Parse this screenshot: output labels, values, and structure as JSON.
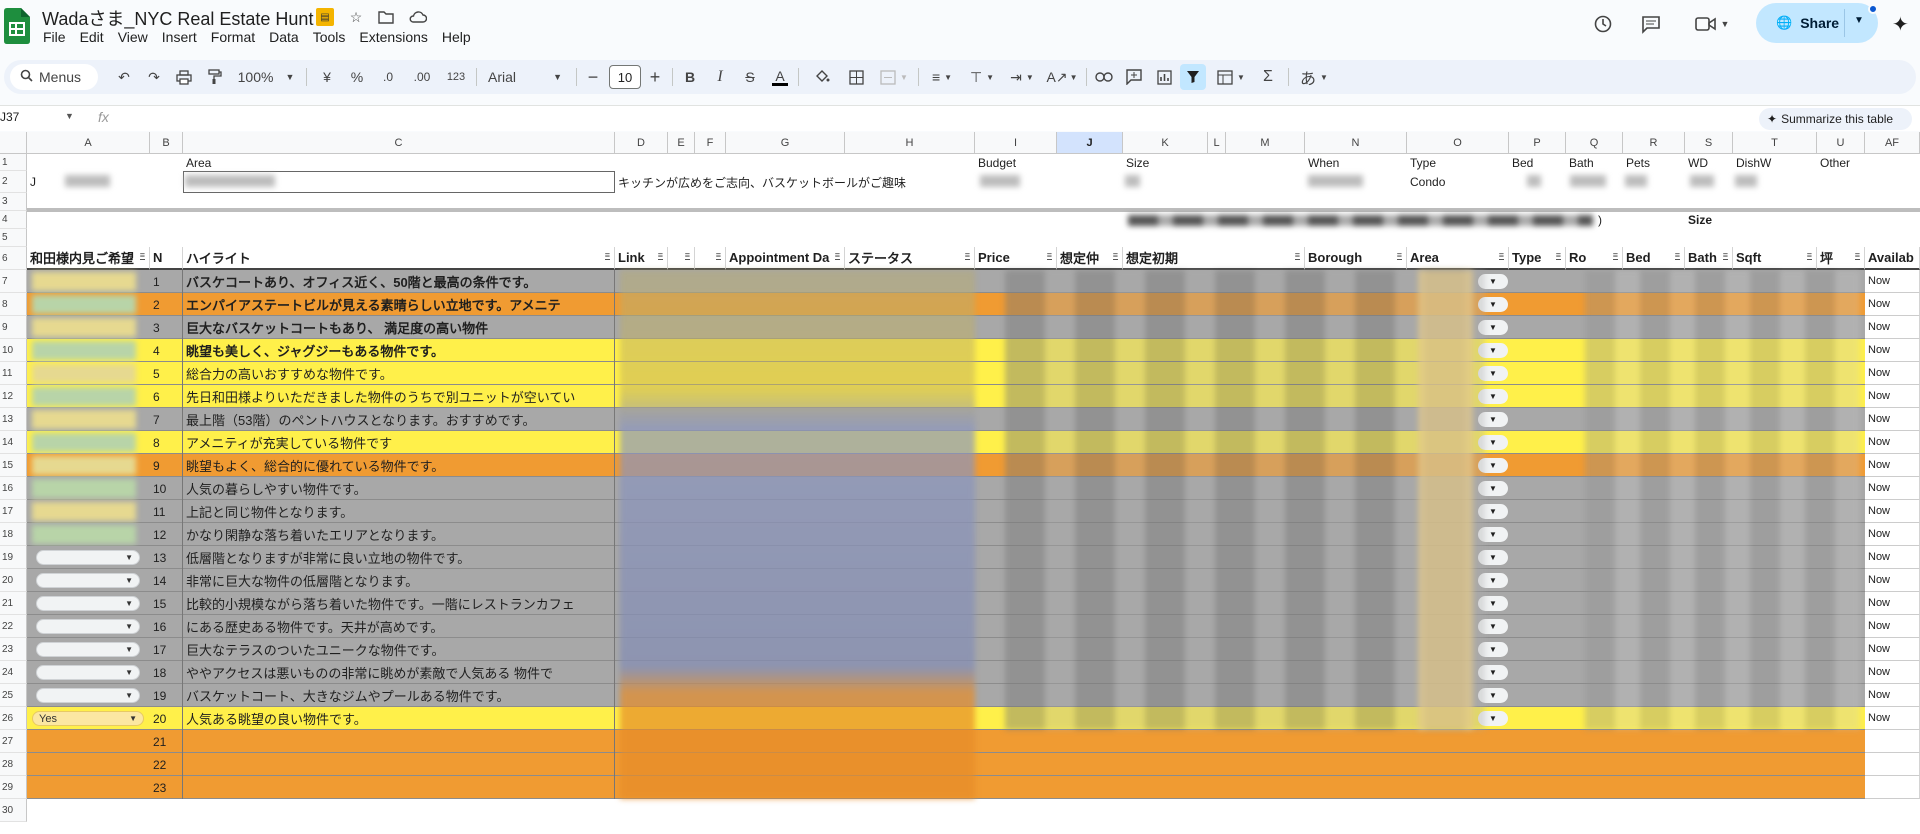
{
  "app": {
    "title": "Wadaさま_NYC Real Estate Hunt",
    "menu": [
      "File",
      "Edit",
      "View",
      "Insert",
      "Format",
      "Data",
      "Tools",
      "Extensions",
      "Help"
    ],
    "share_label": "Share",
    "colors": {
      "accent": "#0b57d0",
      "share_bg": "#c2e7ff",
      "toolbar_bg": "#edf2fa",
      "orange": "#f09b32",
      "yellow": "#fff04a",
      "gray": "#a8a8a8"
    }
  },
  "toolbar": {
    "search_label": "Menus",
    "zoom": "100%",
    "currency": "¥",
    "percent": "%",
    "dec_decrease": ".0",
    "dec_increase": ".00",
    "format_123": "123",
    "font": "Arial",
    "font_size": "10",
    "bold": "B",
    "italic": "I",
    "strike": "S",
    "text_color": "A",
    "sum": "Σ",
    "ime": "あ"
  },
  "formula_bar": {
    "name_box": "J37",
    "fx": "fx",
    "summarize_label": "Summarize this table"
  },
  "grid": {
    "columns": [
      "A",
      "B",
      "C",
      "D",
      "E",
      "F",
      "G",
      "H",
      "I",
      "J",
      "K",
      "L",
      "M",
      "N",
      "O",
      "P",
      "Q",
      "R",
      "S",
      "T",
      "U",
      "AF"
    ],
    "row_numbers": [
      "1",
      "2",
      "3",
      "4",
      "5",
      "6",
      "7",
      "8",
      "9",
      "10",
      "11",
      "12",
      "13",
      "14",
      "15",
      "16",
      "17",
      "18",
      "19",
      "20",
      "21",
      "22",
      "23",
      "24",
      "25",
      "26",
      "27",
      "28",
      "29",
      "30"
    ],
    "row1": {
      "area": "Area",
      "budget": "Budget",
      "size": "Size",
      "when": "When",
      "type": "Type",
      "bed": "Bed",
      "bath": "Bath",
      "pets": "Pets",
      "wd": "WD",
      "dishw": "DishW",
      "other": "Other"
    },
    "row2": {
      "name": "J",
      "note": "キッチンが広めをご志向、バスケットボールがご趣味",
      "type": "Condo"
    },
    "row4": {
      "size": "Size",
      "tail": ")"
    },
    "headers": {
      "a": "和田様内見ご希望",
      "b": "N",
      "c": "ハイライト",
      "d": "Link",
      "g": "Appointment Da",
      "h": "ステータス",
      "i": "Price",
      "j": "想定仲",
      "k": "想定初期",
      "m": "Borough",
      "n": "Area",
      "o": "Type",
      "p": "Ro",
      "q": "Bed",
      "r": "Bath",
      "s": "Sqft",
      "t": "坪",
      "u": "㎡",
      "af": "Availab"
    },
    "listings": [
      {
        "n": "1",
        "text": "バスケコートあり、オフィス近く、50階と最高の条件です。",
        "bold": true,
        "color": "gray",
        "avail": "Now"
      },
      {
        "n": "2",
        "text": "エンパイアステートビルが見える素晴らしい立地です。アメニテ",
        "bold": true,
        "color": "orange",
        "avail": "Now"
      },
      {
        "n": "3",
        "text": "巨大なバスケットコートもあり、            満足度の高い物件",
        "bold": true,
        "color": "gray",
        "avail": "Now"
      },
      {
        "n": "4",
        "text": "眺望も美しく、ジャグジーもある物件です。",
        "bold": true,
        "color": "yellow",
        "avail": "Now"
      },
      {
        "n": "5",
        "text": "         総合力の高いおすすめな物件です。",
        "bold": false,
        "color": "yellow",
        "avail": "Now"
      },
      {
        "n": "6",
        "text": "先日和田様よりいただきました物件のうちで別ユニットが空いてい",
        "bold": false,
        "color": "yellow",
        "avail": "Now"
      },
      {
        "n": "7",
        "text": "最上階（53階）のペントハウスとなります。おすすめです。",
        "bold": false,
        "color": "gray",
        "avail": "Now"
      },
      {
        "n": "8",
        "text": "アメニティが充実している物件です",
        "bold": false,
        "color": "yellow",
        "avail": "Now"
      },
      {
        "n": "9",
        "text": "眺望もよく、総合的に優れている物件です。",
        "bold": false,
        "color": "orange",
        "avail": "Now"
      },
      {
        "n": "10",
        "text": "           人気の暮らしやすい物件です。",
        "bold": false,
        "color": "gray",
        "avail": "Now"
      },
      {
        "n": "11",
        "text": "上記と同じ物件となります。",
        "bold": false,
        "color": "gray",
        "avail": "Now"
      },
      {
        "n": "12",
        "text": "かなり閑静な落ち着いたエリアとなります。",
        "bold": false,
        "color": "gray",
        "avail": "Now"
      },
      {
        "n": "13",
        "text": "低層階となりますが非常に良い立地の物件です。",
        "bold": false,
        "color": "gray",
        "avail": "Now"
      },
      {
        "n": "14",
        "text": "非常に巨大な物件の低層階となります。",
        "bold": false,
        "color": "gray",
        "avail": "Now"
      },
      {
        "n": "15",
        "text": "比較的小規模ながら落ち着いた物件です。一階にレストランカフェ",
        "bold": false,
        "color": "gray",
        "avail": "Now"
      },
      {
        "n": "16",
        "text": "           にある歴史ある物件です。天井が高めです。",
        "bold": false,
        "color": "gray",
        "avail": "Now"
      },
      {
        "n": "17",
        "text": "巨大なテラスのついたユニークな物件です。",
        "bold": false,
        "color": "gray",
        "avail": "Now"
      },
      {
        "n": "18",
        "text": "ややアクセスは悪いものの非常に眺めが素敵で人気ある      物件で",
        "bold": false,
        "color": "gray",
        "avail": "Now"
      },
      {
        "n": "19",
        "text": "バスケットコート、大きなジムやプールある物件です。",
        "bold": false,
        "color": "gray",
        "avail": "Now"
      },
      {
        "n": "20",
        "text": "       人気ある眺望の良い物件です。",
        "bold": false,
        "color": "yellow",
        "avail": "Now",
        "a_value": "Yes"
      },
      {
        "n": "21",
        "text": "",
        "bold": false,
        "color": "orange",
        "avail": ""
      },
      {
        "n": "22",
        "text": "",
        "bold": false,
        "color": "orange",
        "avail": ""
      },
      {
        "n": "23",
        "text": "",
        "bold": false,
        "color": "orange",
        "avail": ""
      }
    ]
  }
}
